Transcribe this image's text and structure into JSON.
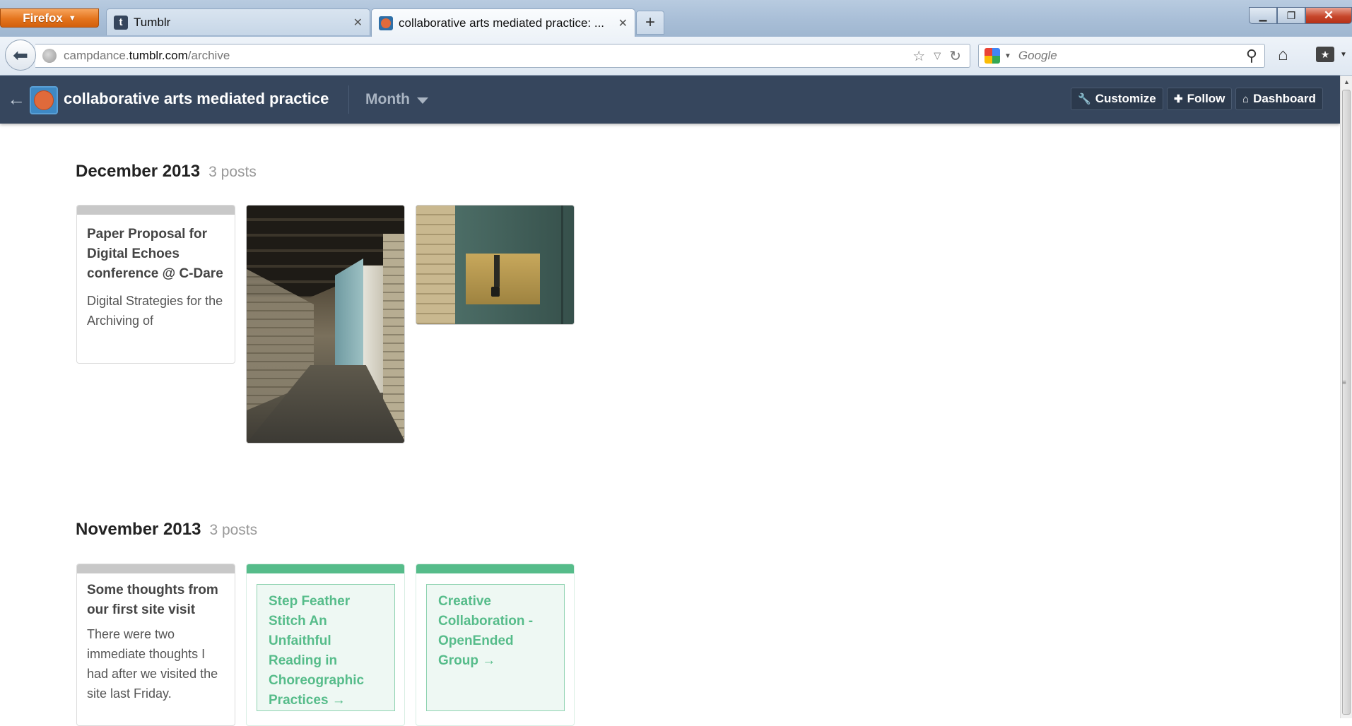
{
  "browser": {
    "menu_button": "Firefox",
    "tabs": [
      {
        "title": "Tumblr",
        "favicon": "tumblr-favicon",
        "active": false
      },
      {
        "title": "collaborative arts mediated practice: ...",
        "favicon": "blog-favicon",
        "active": true
      }
    ],
    "new_tab": "+",
    "url": {
      "prefix": "campdance.",
      "host": "tumblr.com",
      "path": "/archive"
    },
    "search_placeholder": "Google"
  },
  "header": {
    "blog_title": "collaborative arts mediated practice",
    "filter_label": "Month",
    "buttons": {
      "customize": "Customize",
      "follow": "Follow",
      "dashboard": "Dashboard"
    },
    "colors": {
      "bar": "#36465d",
      "button": "#2c3a4d"
    }
  },
  "archive": {
    "months": [
      {
        "title": "December 2013",
        "count": "3 posts",
        "posts": [
          {
            "type": "text",
            "title": "Paper Proposal for Digital Echoes conference @ C-Dare",
            "excerpt": "Digital Strategies for the Archiving of"
          },
          {
            "type": "photo",
            "subject": "corridor-photo"
          },
          {
            "type": "photo",
            "subject": "door-lock-photo"
          }
        ]
      },
      {
        "title": "November 2013",
        "count": "3 posts",
        "posts": [
          {
            "type": "text",
            "title": "Some thoughts from our first site visit",
            "excerpt": "There were two immediate thoughts I had after we visited the site last Friday."
          },
          {
            "type": "link",
            "title": "Step Feather Stitch An Unfaithful Reading in Choreographic Practices →"
          },
          {
            "type": "link",
            "title": "Creative Collaboration - OpenEnded Group →"
          }
        ]
      }
    ],
    "colors": {
      "link_accent": "#56bc8a",
      "text_strip": "#c8c8c8"
    }
  }
}
